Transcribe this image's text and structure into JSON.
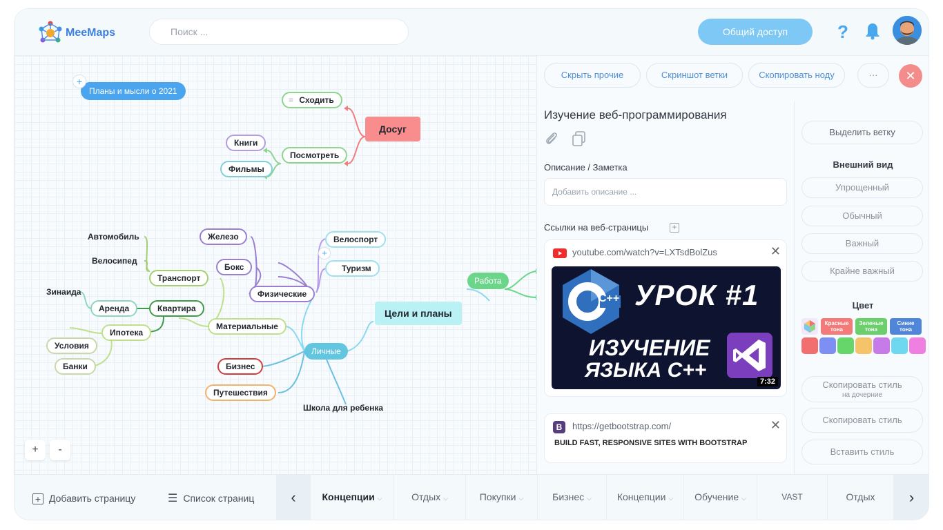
{
  "header": {
    "brand": "MeeMaps",
    "search_placeholder": "Поиск ...",
    "share_label": "Общий доступ",
    "help_glyph": "?"
  },
  "map": {
    "root_tag": "Планы и мысли о 2021",
    "center": "Цели и планы",
    "leisure": "Досуг",
    "go_out": "Сходить",
    "watch": "Посмотреть",
    "books": "Книги",
    "films": "Фильмы",
    "work": "Работа",
    "personal": "Личные",
    "physical": "Физические",
    "iron": "Железо",
    "boxing": "Бокс",
    "cycling": "Велоспорт",
    "tourism": "Туризм",
    "material": "Материальные",
    "transport": "Транспорт",
    "car": "Автомобиль",
    "bicycle": "Велосипед",
    "apartment": "Квартира",
    "rent": "Аренда",
    "zinaida": "Зинаида",
    "mortgage": "Ипотека",
    "conditions": "Условия",
    "banks": "Банки",
    "business": "Бизнес",
    "travel": "Путешествия",
    "school": "Школа для ребенка",
    "zoom_in": "+",
    "zoom_out": "-"
  },
  "panel": {
    "hide_others": "Скрыть прочие",
    "screenshot_branch": "Скриншот ветки",
    "copy_node": "Скопировать ноду",
    "more": "···",
    "close": "✕",
    "title": "Изучение веб-программирования",
    "desc_label": "Описание / Заметка",
    "desc_placeholder": "Добавить описание ...",
    "links_label": "Ссылки на веб-страницы",
    "links": [
      {
        "url": "youtube.com/watch?v=LXTsdBolZus",
        "thumb_title": "УРОК #1",
        "thumb_sub1": "ИЗУЧЕНИЕ",
        "thumb_sub2": "ЯЗЫКА С++",
        "duration": "7:32",
        "logo_text": "C++"
      },
      {
        "url": "https://getbootstrap.com/",
        "caption": "BUILD FAST, RESPONSIVE SITES WITH BOOTSTRAP",
        "favicon": "B"
      }
    ]
  },
  "side": {
    "select_branch": "Выделить ветку",
    "appearance_head": "Внешний вид",
    "appearance": [
      "Упрощенный",
      "Обычный",
      "Важный",
      "Крайне важный"
    ],
    "color_head": "Цвет",
    "presets": [
      {
        "label1": "Красные",
        "label2": "тона",
        "color": "#f47a7a"
      },
      {
        "label1": "Зеленые",
        "label2": "тона",
        "color": "#6bd06b"
      },
      {
        "label1": "Синие",
        "label2": "тона",
        "color": "#4f86d9"
      }
    ],
    "swatches": [
      "#f26f6f",
      "#7d8ff2",
      "#66d66a",
      "#f5c36a",
      "#c77be8",
      "#6dd8f0",
      "#ef7fe0"
    ],
    "copy_style_children": "Скопировать стиль",
    "copy_style_children_sub": "на дочерние",
    "copy_style": "Скопировать стиль",
    "paste_style": "Вставить стиль"
  },
  "footer": {
    "add_page": "Добавить страницу",
    "page_list": "Список страниц",
    "tabs": [
      "Концепции",
      "Отдых",
      "Покупки",
      "Бизнес",
      "Концепции",
      "Обучение",
      "VAST",
      "Отдых"
    ]
  },
  "colors": {
    "accent": "#49a7ee",
    "share": "#7ec8f5",
    "leisure": "#f98d8d",
    "center": "#b9f1f5",
    "work": "#6bd68a",
    "personal": "#63c6e0"
  }
}
